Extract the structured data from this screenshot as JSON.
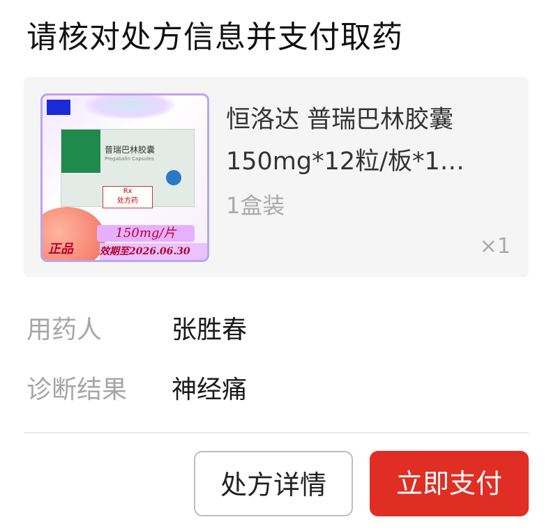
{
  "title": "请核对处方信息并支付取药",
  "product": {
    "name": "恒洛达 普瑞巴林胶囊 150mg*12粒/板*1…",
    "spec": "1盒装",
    "quantity": "×1",
    "image": {
      "box_name": "普瑞巴林胶囊",
      "box_sub": "Pregabalin Capsules",
      "rx_badge_top": "Rx",
      "rx_badge": "处方药",
      "dose": "150mg/片",
      "badge": "正品",
      "expiry": "效期至2026.06.30"
    }
  },
  "patient": {
    "label": "用药人",
    "value": "张胜春"
  },
  "diagnosis": {
    "label": "诊断结果",
    "value": "神经痛"
  },
  "buttons": {
    "detail": "处方详情",
    "pay": "立即支付"
  },
  "colors": {
    "pay_red": "#e02e24",
    "card_bg": "#f5f5f5"
  }
}
